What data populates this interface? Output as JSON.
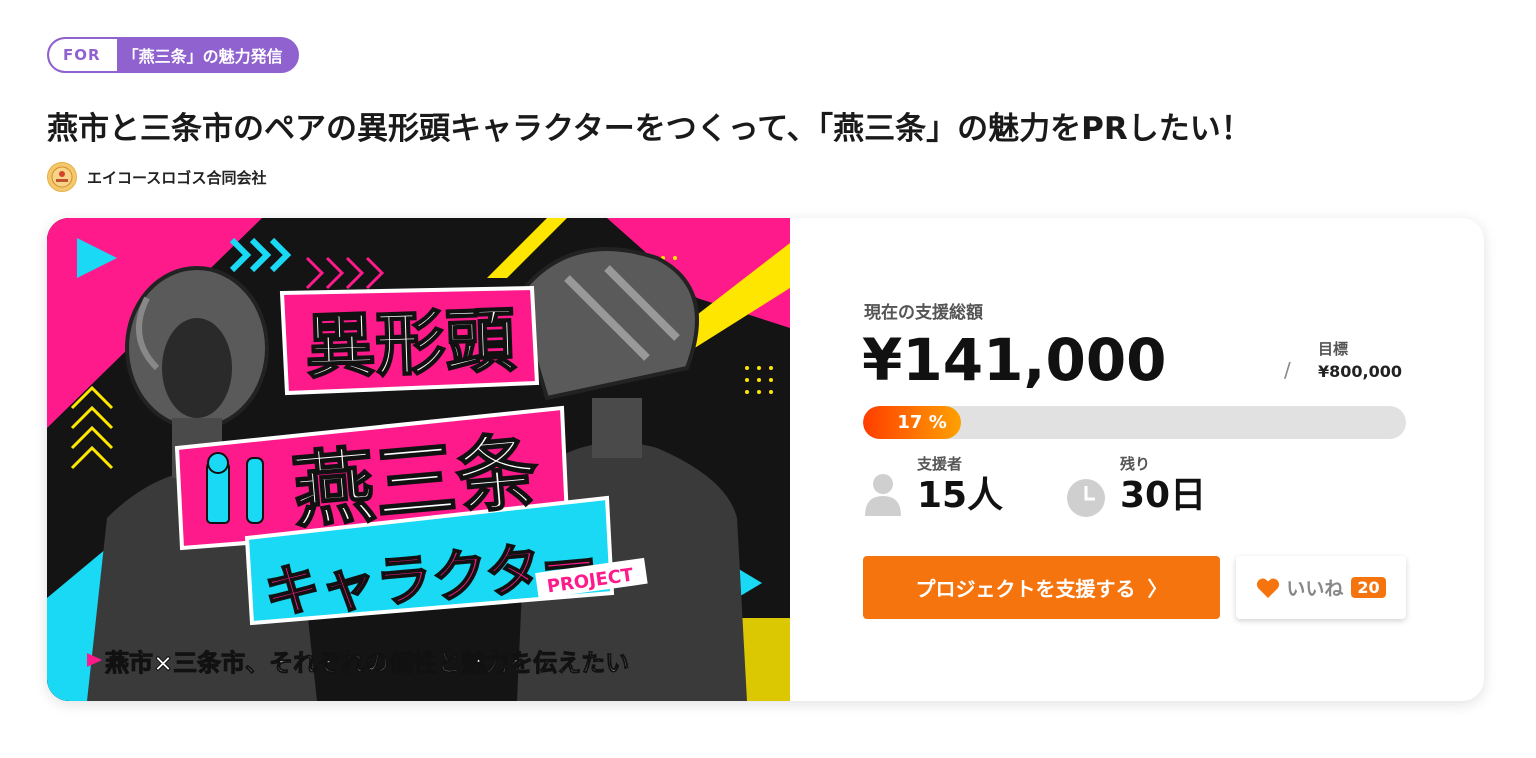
{
  "badge": {
    "prefix": "FOR",
    "text": "「燕三条」の魅力発信",
    "color": "#8f62cf"
  },
  "page": {
    "title": "燕市と三条市のペアの異形頭キャラクターをつくって、「燕三条」の魅力をPRしたい！"
  },
  "owner": {
    "name": "エイコースロゴス合同会社",
    "avatar_icon": "company-logo-icon"
  },
  "hero": {
    "title_line1": "異形頭",
    "title_line2": "燕三条",
    "title_line3": "キャラクター",
    "project_tag": "PROJECT",
    "caption": "燕市×三条市、それぞれの個性と魅力を伝えたい",
    "colors": {
      "pink": "#ff1a8c",
      "cyan": "#19d9f5",
      "yellow": "#ffe600"
    }
  },
  "funding": {
    "label": "現在の支援総額",
    "amount": "¥141,000",
    "slash": "/",
    "goal_label": "目標",
    "goal_value": "¥800,000",
    "percent_text": "17 %",
    "percent_value": 17,
    "accent": "#f5740d"
  },
  "stats": {
    "supporters_label": "支援者",
    "supporters_value": "15人",
    "supporters_icon": "person-icon",
    "remaining_label": "残り",
    "remaining_value": "30日",
    "remaining_icon": "clock-icon"
  },
  "actions": {
    "support_label": "プロジェクトを支援する",
    "support_chevron": "〉",
    "like_label": "いいね",
    "like_count": "20",
    "like_icon": "heart-icon"
  }
}
